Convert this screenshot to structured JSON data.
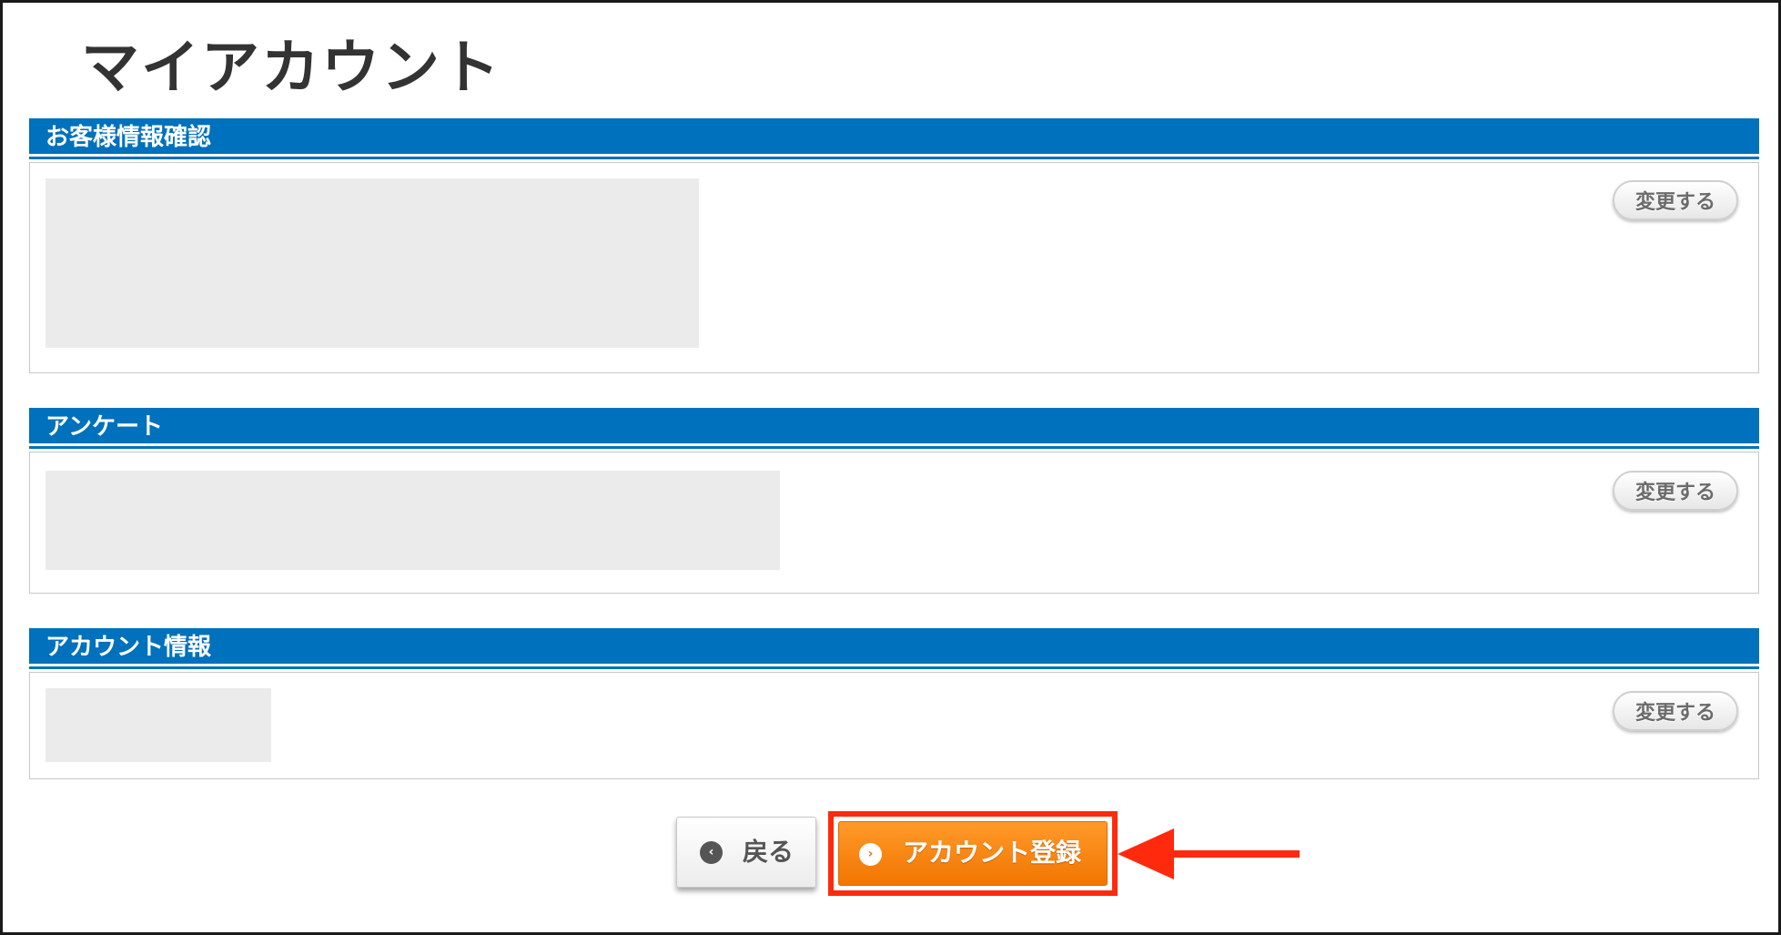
{
  "page": {
    "title": "マイアカウント"
  },
  "sections": [
    {
      "title": "お客様情報確認",
      "change_label": "変更する"
    },
    {
      "title": "アンケート",
      "change_label": "変更する"
    },
    {
      "title": "アカウント情報",
      "change_label": "変更する"
    }
  ],
  "actions": {
    "back_label": "戻る",
    "register_label": "アカウント登録"
  },
  "icons": {
    "back": "chevron-left-circle-icon",
    "register": "chevron-right-circle-icon",
    "annotation": "red-arrow-left-icon"
  },
  "colors": {
    "section_header": "#0071bc",
    "register_button": "#f27500",
    "highlight": "#ff2a0d",
    "title_text": "#333333"
  }
}
